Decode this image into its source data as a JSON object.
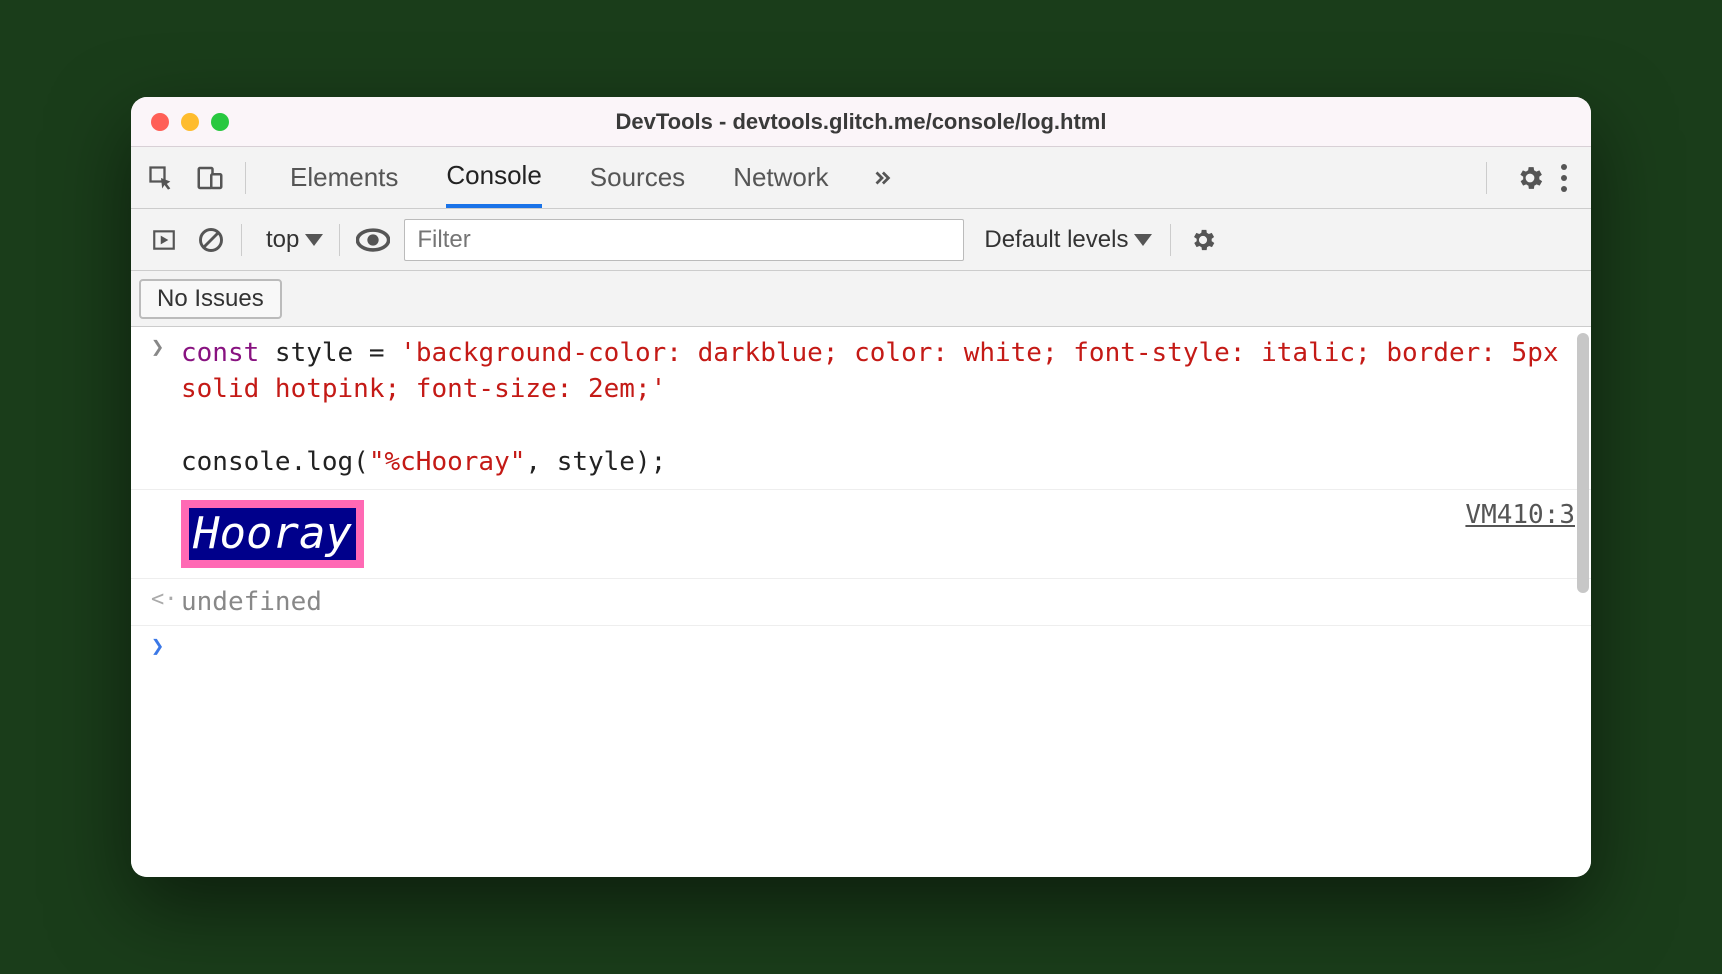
{
  "titlebar": {
    "title": "DevTools - devtools.glitch.me/console/log.html"
  },
  "tabs": {
    "items": [
      "Elements",
      "Console",
      "Sources",
      "Network"
    ],
    "active_index": 1
  },
  "toolbar": {
    "context": "top",
    "filter_placeholder": "Filter",
    "levels": "Default levels"
  },
  "issues": {
    "label": "No Issues"
  },
  "console": {
    "input_code": {
      "keyword": "const",
      "line1_pre": " style = ",
      "line1_str": "'background-color: darkblue; color: white; font-style: italic; border: 5px solid hotpink; font-size: 2em;'",
      "line2": "console.log(",
      "line2_str": "\"%cHooray\"",
      "line2_after": ", style);"
    },
    "output": {
      "styled_text": "Hooray",
      "source": "VM410:3"
    },
    "return_value": "undefined"
  }
}
